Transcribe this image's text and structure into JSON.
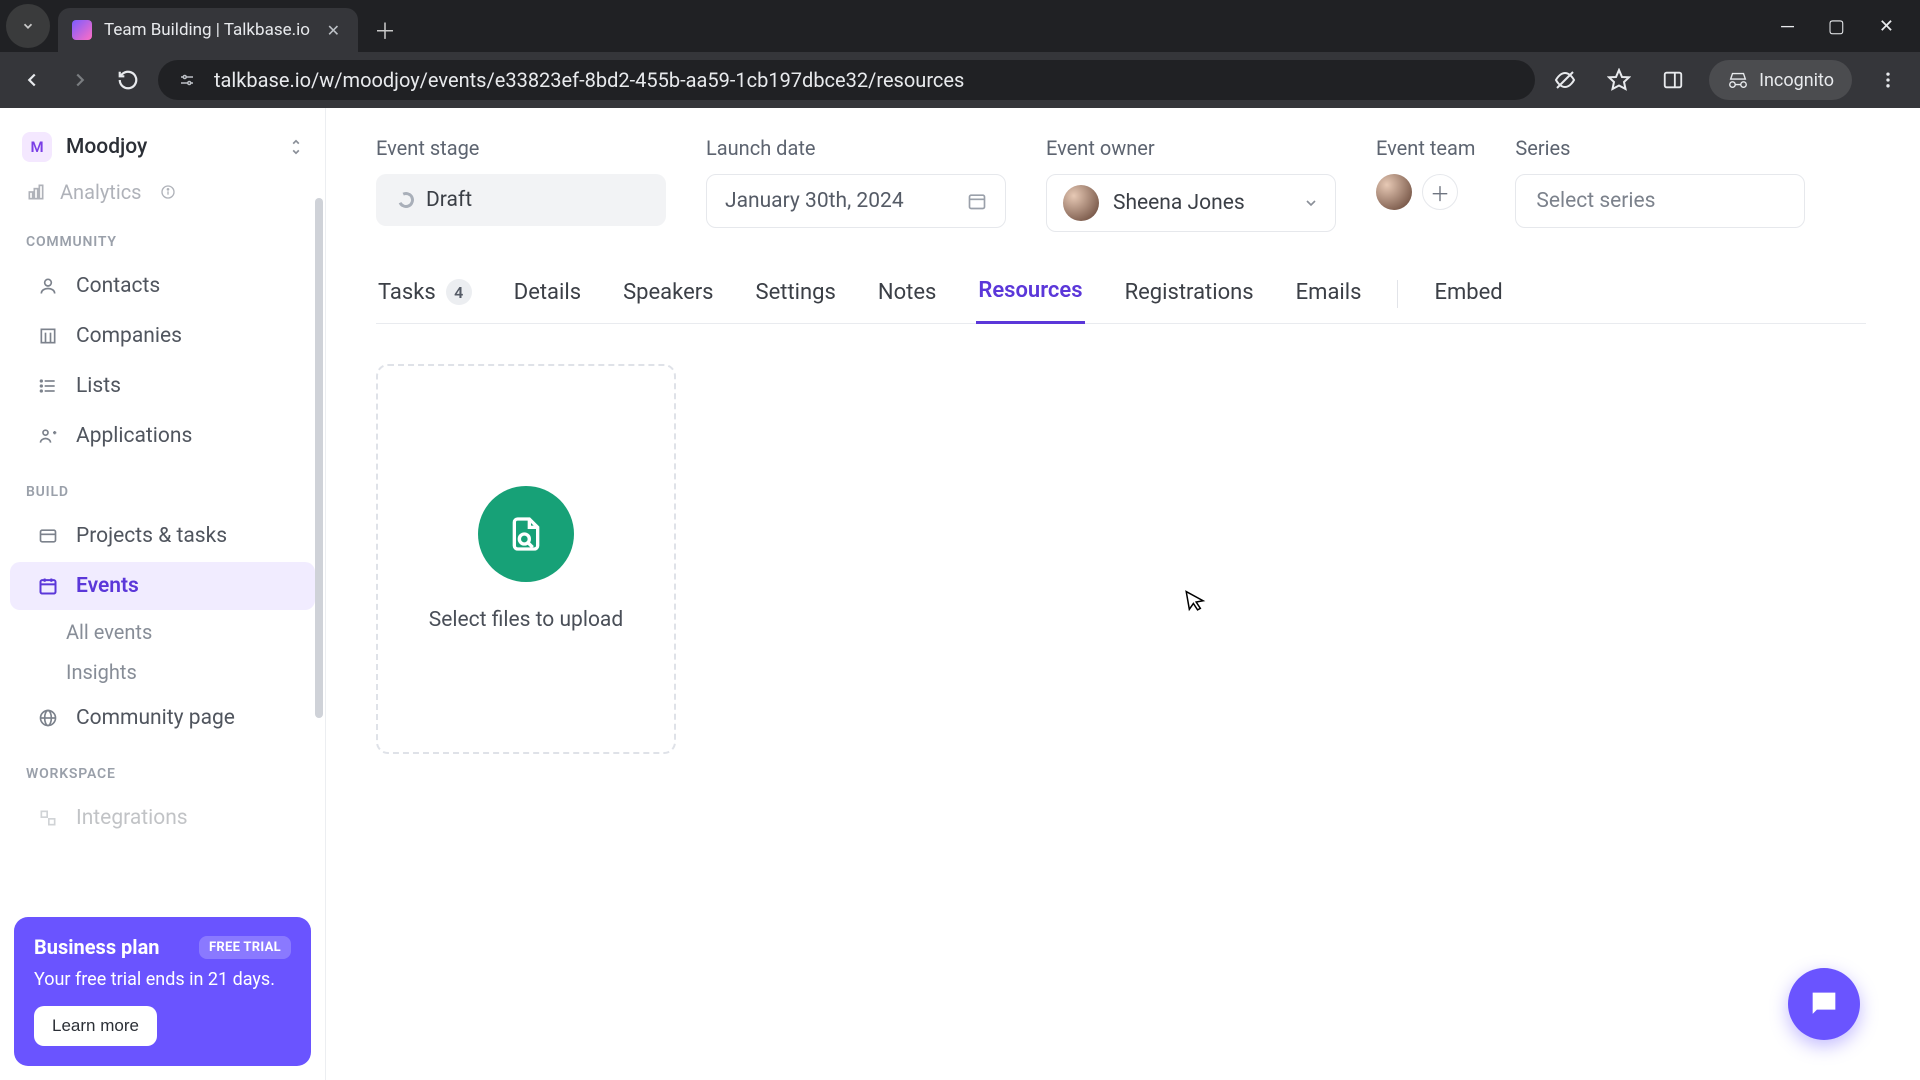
{
  "browser": {
    "tab_title": "Team Building | Talkbase.io",
    "url": "talkbase.io/w/moodjoy/events/e33823ef-8bd2-455b-aa59-1cb197dbce32/resources",
    "incognito_label": "Incognito"
  },
  "workspace": {
    "badge_letter": "M",
    "name": "Moodjoy"
  },
  "sidebar": {
    "peek_item": "Analytics",
    "section_community": "COMMUNITY",
    "contacts": "Contacts",
    "companies": "Companies",
    "lists": "Lists",
    "applications": "Applications",
    "section_build": "BUILD",
    "projects": "Projects & tasks",
    "events": "Events",
    "all_events": "All events",
    "insights": "Insights",
    "community_page": "Community page",
    "section_workspace": "WORKSPACE",
    "integrations": "Integrations"
  },
  "promo": {
    "title": "Business plan",
    "badge": "FREE TRIAL",
    "subtitle": "Your free trial ends in 21 days.",
    "button": "Learn more"
  },
  "event": {
    "labels": {
      "stage": "Event stage",
      "launch": "Launch date",
      "owner": "Event owner",
      "team": "Event team",
      "series": "Series"
    },
    "stage_value": "Draft",
    "launch_value": "January 30th, 2024",
    "owner_value": "Sheena Jones",
    "series_placeholder": "Select series"
  },
  "tabs": {
    "tasks": "Tasks",
    "tasks_count": "4",
    "details": "Details",
    "speakers": "Speakers",
    "settings": "Settings",
    "notes": "Notes",
    "resources": "Resources",
    "registrations": "Registrations",
    "emails": "Emails",
    "embed": "Embed"
  },
  "resources": {
    "upload_label": "Select files to upload"
  }
}
